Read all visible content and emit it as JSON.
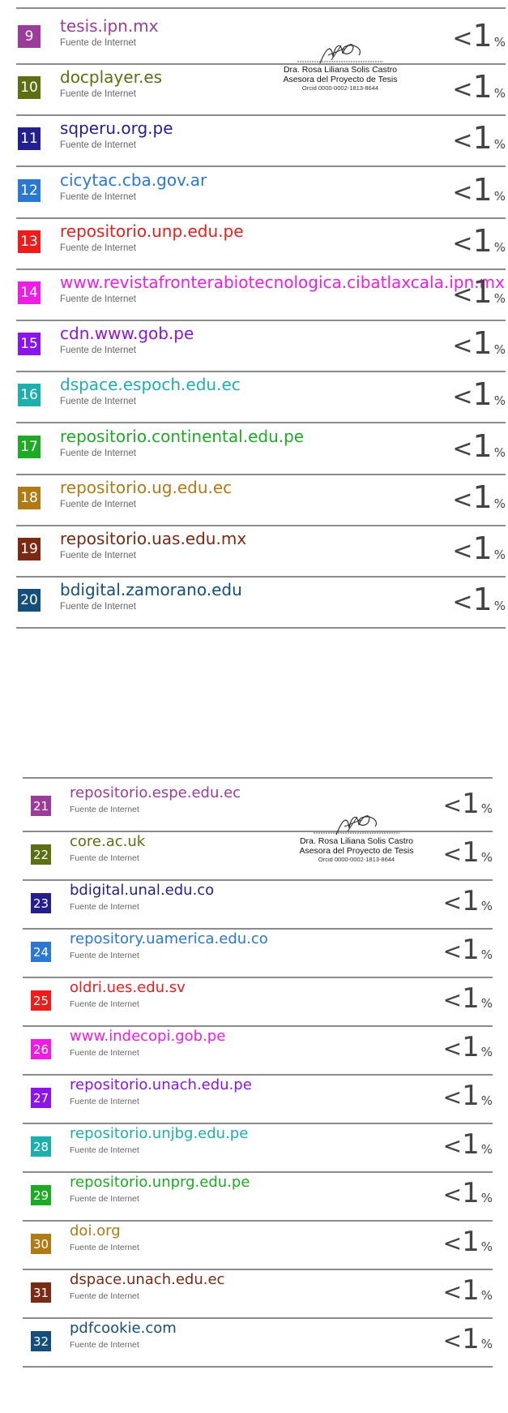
{
  "colors": {
    "c9": "#9b3c9b",
    "c10": "#5a7012",
    "c11": "#231f8f",
    "c12": "#2a78d2",
    "c13": "#f01c1c",
    "c14": "#f01ce6",
    "c15": "#8a14ea",
    "c16": "#1eaeae",
    "c17": "#1eaa24",
    "c18": "#b07a14",
    "c19": "#7a2a12",
    "c20": "#144e7a",
    "rule": "#8c8c8c"
  },
  "block1": {
    "rows": [
      {
        "num": "9",
        "source": "tesis.ipn.mx",
        "type": "Fuente de Internet",
        "lt": "<",
        "one": "1",
        "pct": "%",
        "color": "#9b3c9b"
      },
      {
        "num": "10",
        "source": "docplayer.es",
        "type": "Fuente de Internet",
        "lt": "<",
        "one": "1",
        "pct": "%",
        "color": "#5a7012"
      },
      {
        "num": "11",
        "source": "sqperu.org.pe",
        "type": "Fuente de Internet",
        "lt": "<",
        "one": "1",
        "pct": "%",
        "color": "#231f8f"
      },
      {
        "num": "12",
        "source": "cicytac.cba.gov.ar",
        "type": "Fuente de Internet",
        "lt": "<",
        "one": "1",
        "pct": "%",
        "color": "#2a78d2"
      },
      {
        "num": "13",
        "source": "repositorio.unp.edu.pe",
        "type": "Fuente de Internet",
        "lt": "<",
        "one": "1",
        "pct": "%",
        "color": "#f01c1c"
      },
      {
        "num": "14",
        "source": "www.revistafronterabiotecnologica.cibatlaxcala.ipn.mx",
        "type": "Fuente de Internet",
        "lt": "<",
        "one": "1",
        "pct": "%",
        "color": "#f01ce6"
      },
      {
        "num": "15",
        "source": "cdn.www.gob.pe",
        "type": "Fuente de Internet",
        "lt": "<",
        "one": "1",
        "pct": "%",
        "color": "#8a14ea"
      },
      {
        "num": "16",
        "source": "dspace.espoch.edu.ec",
        "type": "Fuente de Internet",
        "lt": "<",
        "one": "1",
        "pct": "%",
        "color": "#1eaeae"
      },
      {
        "num": "17",
        "source": "repositorio.continental.edu.pe",
        "type": "Fuente de Internet",
        "lt": "<",
        "one": "1",
        "pct": "%",
        "color": "#1eaa24"
      },
      {
        "num": "18",
        "source": "repositorio.ug.edu.ec",
        "type": "Fuente de Internet",
        "lt": "<",
        "one": "1",
        "pct": "%",
        "color": "#b07a14"
      },
      {
        "num": "19",
        "source": "repositorio.uas.edu.mx",
        "type": "Fuente de Internet",
        "lt": "<",
        "one": "1",
        "pct": "%",
        "color": "#7a2a12"
      },
      {
        "num": "20",
        "source": "bdigital.zamorano.edu",
        "type": "Fuente de Internet",
        "lt": "<",
        "one": "1",
        "pct": "%",
        "color": "#144e7a"
      }
    ],
    "stamp": {
      "name": "Dra. Rosa Liliana Solis Castro",
      "role": "Asesora del Proyecto de Tesis",
      "orcid": "Orcid 0000-0002-1813-8644"
    }
  },
  "block2": {
    "rows": [
      {
        "num": "21",
        "source": "repositorio.espe.edu.ec",
        "type": "Fuente de Internet",
        "lt": "<",
        "one": "1",
        "pct": "%",
        "color": "#9b3c9b"
      },
      {
        "num": "22",
        "source": "core.ac.uk",
        "type": "Fuente de Internet",
        "lt": "<",
        "one": "1",
        "pct": "%",
        "color": "#5a7012"
      },
      {
        "num": "23",
        "source": "bdigital.unal.edu.co",
        "type": "Fuente de Internet",
        "lt": "<",
        "one": "1",
        "pct": "%",
        "color": "#231f8f"
      },
      {
        "num": "24",
        "source": "repository.uamerica.edu.co",
        "type": "Fuente de Internet",
        "lt": "<",
        "one": "1",
        "pct": "%",
        "color": "#2a78d2"
      },
      {
        "num": "25",
        "source": "oldri.ues.edu.sv",
        "type": "Fuente de Internet",
        "lt": "<",
        "one": "1",
        "pct": "%",
        "color": "#f01c1c"
      },
      {
        "num": "26",
        "source": "www.indecopi.gob.pe",
        "type": "Fuente de Internet",
        "lt": "<",
        "one": "1",
        "pct": "%",
        "color": "#f01ce6"
      },
      {
        "num": "27",
        "source": "repositorio.unach.edu.pe",
        "type": "Fuente de Internet",
        "lt": "<",
        "one": "1",
        "pct": "%",
        "color": "#8a14ea"
      },
      {
        "num": "28",
        "source": "repositorio.unjbg.edu.pe",
        "type": "Fuente de Internet",
        "lt": "<",
        "one": "1",
        "pct": "%",
        "color": "#1eaeae"
      },
      {
        "num": "29",
        "source": "repositorio.unprg.edu.pe",
        "type": "Fuente de Internet",
        "lt": "<",
        "one": "1",
        "pct": "%",
        "color": "#1eaa24"
      },
      {
        "num": "30",
        "source": "doi.org",
        "type": "Fuente de Internet",
        "lt": "<",
        "one": "1",
        "pct": "%",
        "color": "#b07a14"
      },
      {
        "num": "31",
        "source": "dspace.unach.edu.ec",
        "type": "Fuente de Internet",
        "lt": "<",
        "one": "1",
        "pct": "%",
        "color": "#7a2a12"
      },
      {
        "num": "32",
        "source": "pdfcookie.com",
        "type": "Fuente de Internet",
        "lt": "<",
        "one": "1",
        "pct": "%",
        "color": "#144e7a"
      }
    ],
    "stamp": {
      "name": "Dra. Rosa Liliana Solis Castro",
      "role": "Asesora del Proyecto de Tesis",
      "orcid": "Orcid 0000-0002-1813-8644"
    }
  }
}
